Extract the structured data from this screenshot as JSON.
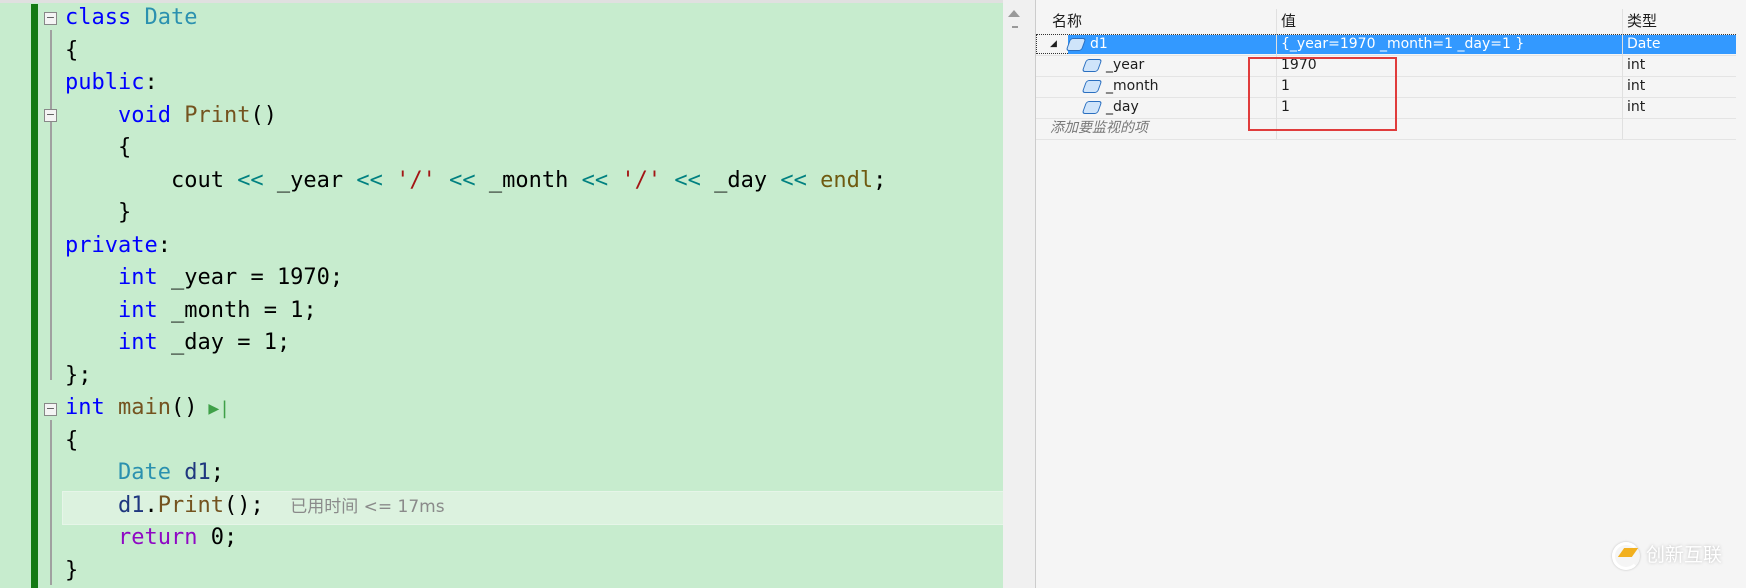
{
  "editor": {
    "lines": [
      [
        [
          "class",
          "kw"
        ],
        [
          " "
        ],
        [
          "Date",
          "ty"
        ]
      ],
      [
        [
          "{"
        ]
      ],
      [
        [
          "public",
          "kw"
        ],
        [
          ":"
        ]
      ],
      [
        [
          "    "
        ],
        [
          "void",
          "kw"
        ],
        [
          " "
        ],
        [
          "Print",
          "fn"
        ],
        [
          "()"
        ]
      ],
      [
        [
          "    {"
        ]
      ],
      [
        [
          "        cout "
        ],
        [
          "<<",
          "op"
        ],
        [
          " _year "
        ],
        [
          "<<",
          "op"
        ],
        [
          " "
        ],
        [
          "'/'",
          "st"
        ],
        [
          " "
        ],
        [
          "<<",
          "op"
        ],
        [
          " _month "
        ],
        [
          "<<",
          "op"
        ],
        [
          " "
        ],
        [
          "'/'",
          "st"
        ],
        [
          " "
        ],
        [
          "<<",
          "op"
        ],
        [
          " _day "
        ],
        [
          "<<",
          "op"
        ],
        [
          " "
        ],
        [
          "endl",
          "mc"
        ],
        [
          ";"
        ]
      ],
      [
        [
          "    }"
        ]
      ],
      [
        [
          "private",
          "kw"
        ],
        [
          ":"
        ]
      ],
      [
        [
          "    "
        ],
        [
          "int",
          "kw"
        ],
        [
          " _year = 1970;"
        ]
      ],
      [
        [
          "    "
        ],
        [
          "int",
          "kw"
        ],
        [
          " _month = 1;"
        ]
      ],
      [
        [
          "    "
        ],
        [
          "int",
          "kw"
        ],
        [
          " _day = 1;"
        ]
      ],
      [
        [
          "};"
        ]
      ],
      [
        [
          "int",
          "kw"
        ],
        [
          " "
        ],
        [
          "main",
          "fn"
        ],
        [
          "()"
        ]
      ],
      [
        [
          "{"
        ]
      ],
      [
        [
          "    "
        ],
        [
          "Date",
          "ty"
        ],
        [
          " "
        ],
        [
          "d1",
          "va"
        ],
        [
          ";"
        ]
      ],
      [
        [
          "    "
        ],
        [
          "d1",
          "va"
        ],
        [
          "."
        ],
        [
          "Print",
          "fn"
        ],
        [
          "();"
        ]
      ],
      [
        [
          "    "
        ],
        [
          "return",
          "ct"
        ],
        [
          " 0;"
        ]
      ],
      [
        [
          "}"
        ]
      ]
    ],
    "elapsed_hint": "已用时间 <= 17ms",
    "run_to_cursor_icon": "run-to-click-icon"
  },
  "watch": {
    "columns": {
      "name": "名称",
      "value": "值",
      "type": "类型"
    },
    "rows": [
      {
        "name": "d1",
        "value": "{_year=1970 _month=1 _day=1 }",
        "type": "Date",
        "selected": true,
        "expanded": true
      },
      {
        "name": "_year",
        "value": "1970",
        "type": "int"
      },
      {
        "name": "_month",
        "value": "1",
        "type": "int"
      },
      {
        "name": "_day",
        "value": "1",
        "type": "int"
      }
    ],
    "add_item_placeholder": "添加要监视的项"
  },
  "colors": {
    "highlight_box": "#e03c3c",
    "selection": "#3399ff",
    "editor_bg": "#c7ecce"
  },
  "watermark": "创新互联"
}
